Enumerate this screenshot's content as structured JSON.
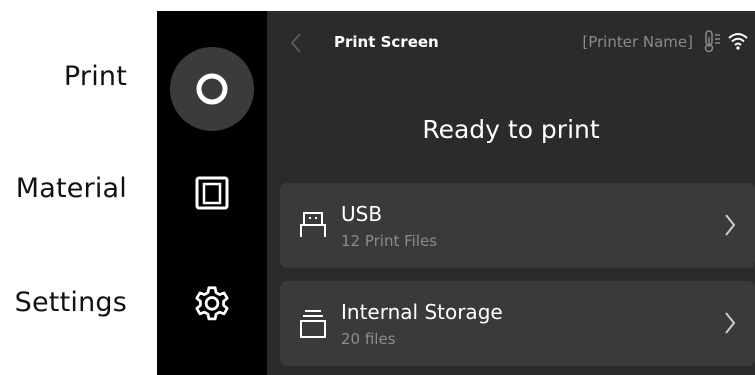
{
  "annotations": {
    "print": "Print",
    "material": "Material",
    "settings": "Settings"
  },
  "nav": {
    "items": [
      {
        "id": "print",
        "icon": "ring-icon",
        "active": true
      },
      {
        "id": "material",
        "icon": "square-frame-icon",
        "active": false
      },
      {
        "id": "settings",
        "icon": "gear-icon",
        "active": false
      }
    ]
  },
  "header": {
    "title": "Print Screen",
    "printer_name": "[Printer Name]"
  },
  "main": {
    "heading": "Ready to print",
    "sources": [
      {
        "title": "USB",
        "subtitle": "12 Print Files",
        "icon": "usb-drive-icon"
      },
      {
        "title": "Internal Storage",
        "subtitle": "20 files",
        "icon": "storage-stack-icon"
      }
    ]
  },
  "colors": {
    "rail_bg": "#000000",
    "screen_bg": "#2b2b2b",
    "card_bg": "#3a3a3a",
    "active_bg": "#3b3b3b",
    "text_primary": "#ffffff",
    "text_secondary": "#8c8c8c"
  }
}
